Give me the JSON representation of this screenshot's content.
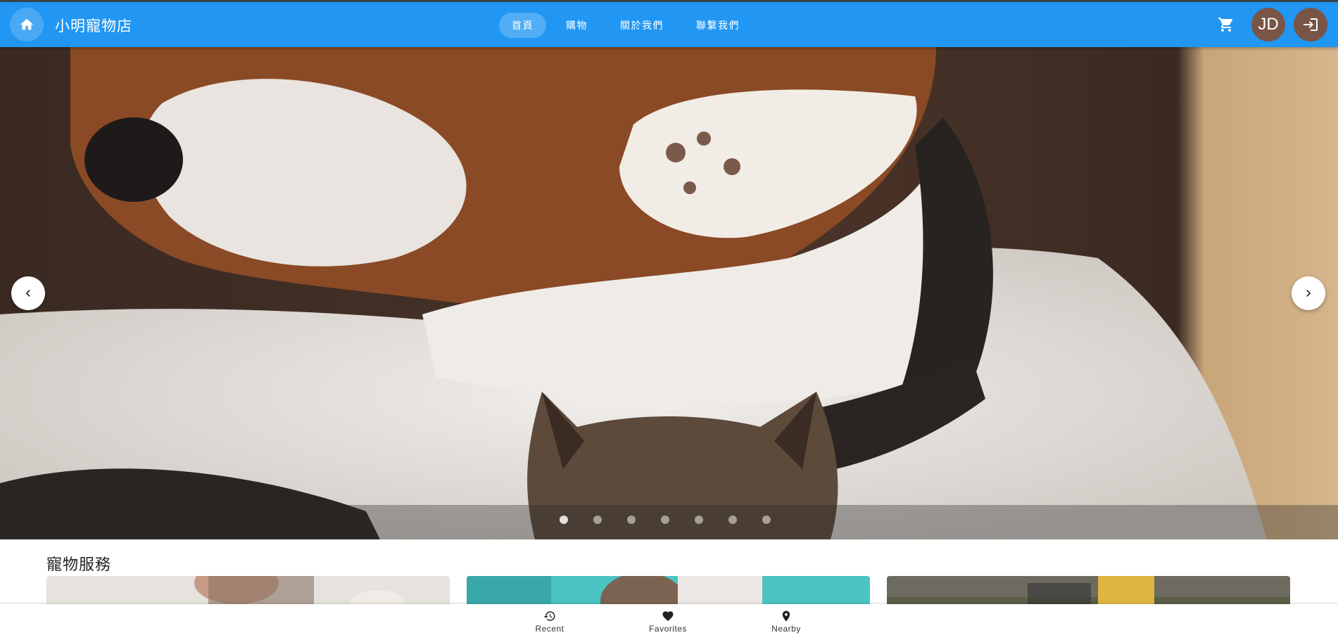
{
  "header": {
    "brand": "小明寵物店",
    "nav": [
      {
        "label": "首頁",
        "active": true
      },
      {
        "label": "購物",
        "active": false
      },
      {
        "label": "關於我們",
        "active": false
      },
      {
        "label": "聯繫我們",
        "active": false
      }
    ],
    "avatar_initials": "JD",
    "icons": {
      "home": "home-icon",
      "cart": "cart-icon",
      "login": "login-icon"
    }
  },
  "carousel": {
    "slide_count": 7,
    "active_index": 0,
    "icons": {
      "prev": "chevron-left-icon",
      "next": "chevron-right-icon"
    }
  },
  "services": {
    "title": "寵物服務",
    "cards": [
      {
        "name": "service-card-grooming"
      },
      {
        "name": "service-card-vet"
      },
      {
        "name": "service-card-walking"
      }
    ]
  },
  "bottom_nav": [
    {
      "label": "Recent",
      "icon": "history-icon"
    },
    {
      "label": "Favorites",
      "icon": "heart-icon"
    },
    {
      "label": "Nearby",
      "icon": "location-pin-icon"
    }
  ],
  "colors": {
    "primary": "#2196f3",
    "avatar": "#795548"
  }
}
